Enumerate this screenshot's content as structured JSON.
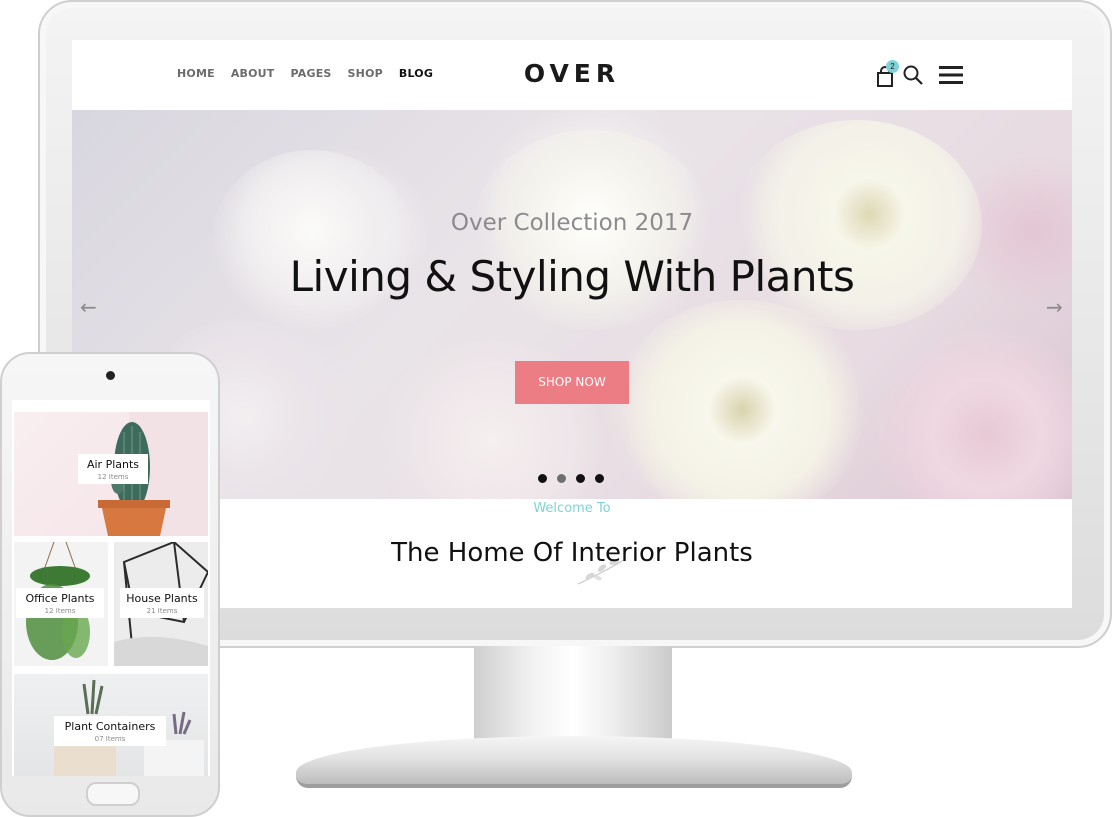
{
  "site": {
    "logo": "OVER",
    "nav": [
      {
        "label": "HOME"
      },
      {
        "label": "ABOUT"
      },
      {
        "label": "PAGES"
      },
      {
        "label": "SHOP"
      },
      {
        "label": "BLOG"
      }
    ],
    "cart_count": "2",
    "icons": [
      "cart-icon",
      "search-icon",
      "menu-icon"
    ]
  },
  "hero": {
    "subtitle": "Over Collection 2017",
    "title": "Living & Styling With Plants",
    "button_label": "SHOP NOW",
    "prev_arrow": "←",
    "next_arrow": "→",
    "slide_count": 4,
    "active_slide": 1
  },
  "welcome": {
    "kicker": "Welcome To",
    "title": "The Home Of Interior Plants"
  },
  "mobile": {
    "categories": [
      {
        "name": "Air Plants",
        "count": "12 Items"
      },
      {
        "name": "Office Plants",
        "count": "12 Items"
      },
      {
        "name": "House Plants",
        "count": "21 Items"
      },
      {
        "name": "Plant Containers",
        "count": "07 Items"
      }
    ]
  },
  "colors": {
    "accent_pink": "#ec7d84",
    "accent_teal": "#7fd3d6",
    "text_dark": "#111111"
  }
}
